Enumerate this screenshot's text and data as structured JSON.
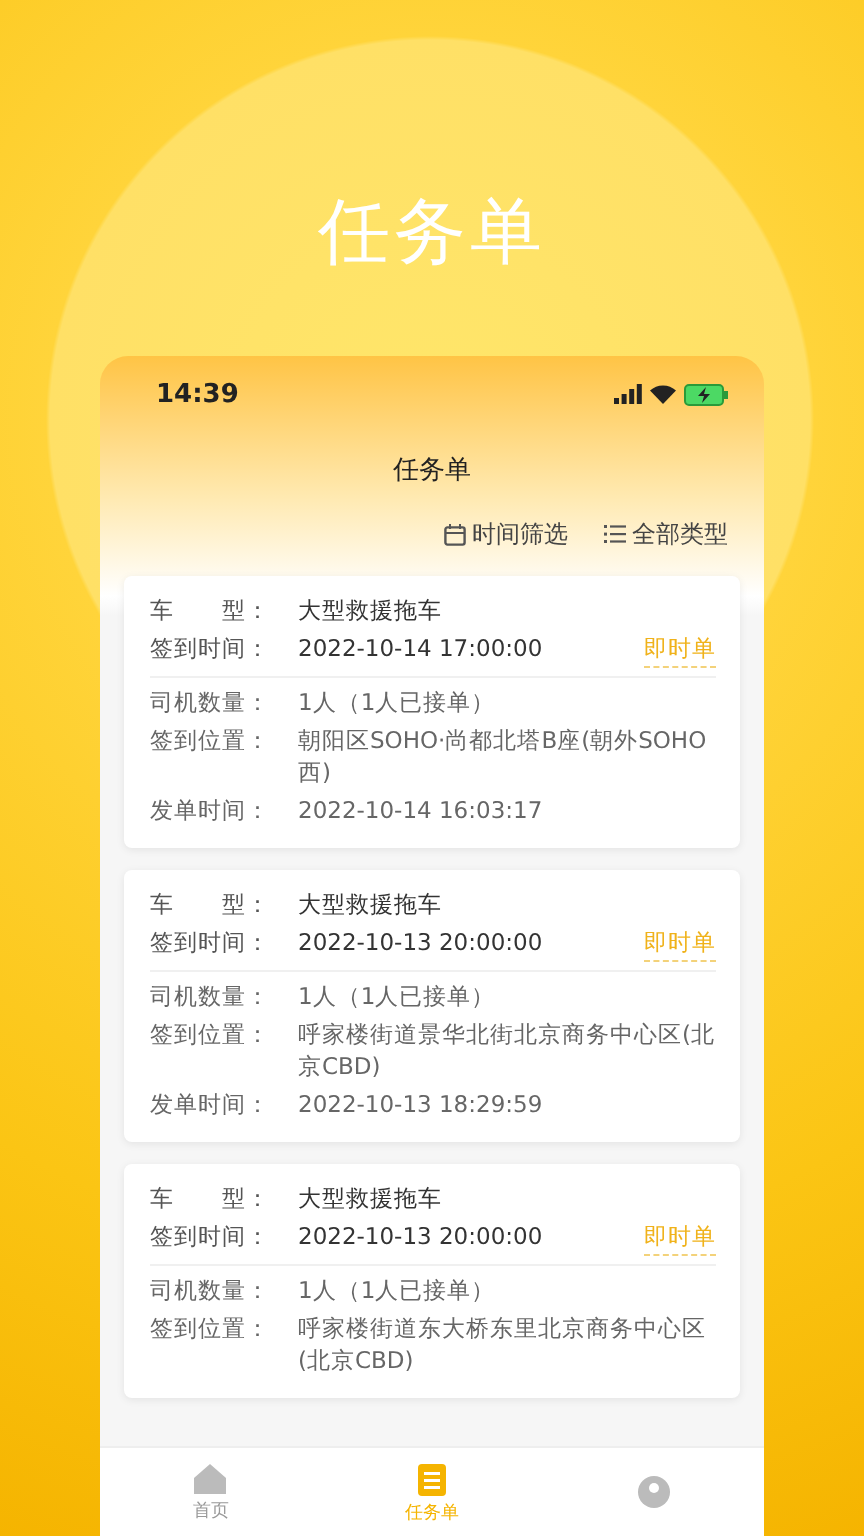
{
  "headline": "任务单",
  "status_bar": {
    "time": "14:39"
  },
  "header": {
    "title": "任务单",
    "filters": [
      "时间筛选",
      "全部类型"
    ]
  },
  "orders": [
    {
      "tag": "即时单",
      "summary": [
        {
          "label": "车　　型：",
          "value": "大型救援拖车"
        },
        {
          "label": "签到时间：",
          "value": "2022-10-14 17:00:00"
        }
      ],
      "details": [
        {
          "label": "司机数量：",
          "value": "1人（1人已接单）"
        },
        {
          "label": "签到位置：",
          "value": "朝阳区SOHO·尚都北塔B座(朝外SOHO西)"
        },
        {
          "label": "发单时间：",
          "value": "2022-10-14 16:03:17"
        }
      ]
    },
    {
      "tag": "即时单",
      "summary": [
        {
          "label": "车　　型：",
          "value": "大型救援拖车"
        },
        {
          "label": "签到时间：",
          "value": "2022-10-13 20:00:00"
        }
      ],
      "details": [
        {
          "label": "司机数量：",
          "value": "1人（1人已接单）"
        },
        {
          "label": "签到位置：",
          "value": "呼家楼街道景华北街北京商务中心区(北京CBD)"
        },
        {
          "label": "发单时间：",
          "value": "2022-10-13 18:29:59"
        }
      ]
    },
    {
      "tag": "即时单",
      "summary": [
        {
          "label": "车　　型：",
          "value": "大型救援拖车"
        },
        {
          "label": "签到时间：",
          "value": "2022-10-13 20:00:00"
        }
      ],
      "details": [
        {
          "label": "司机数量：",
          "value": "1人（1人已接单）"
        },
        {
          "label": "签到位置：",
          "value": "呼家楼街道东大桥东里北京商务中心区(北京CBD)"
        }
      ]
    }
  ],
  "tab_bar": [
    {
      "label": "首页",
      "selected": false
    },
    {
      "label": "任务单",
      "selected": true
    },
    {
      "selected": false
    }
  ]
}
